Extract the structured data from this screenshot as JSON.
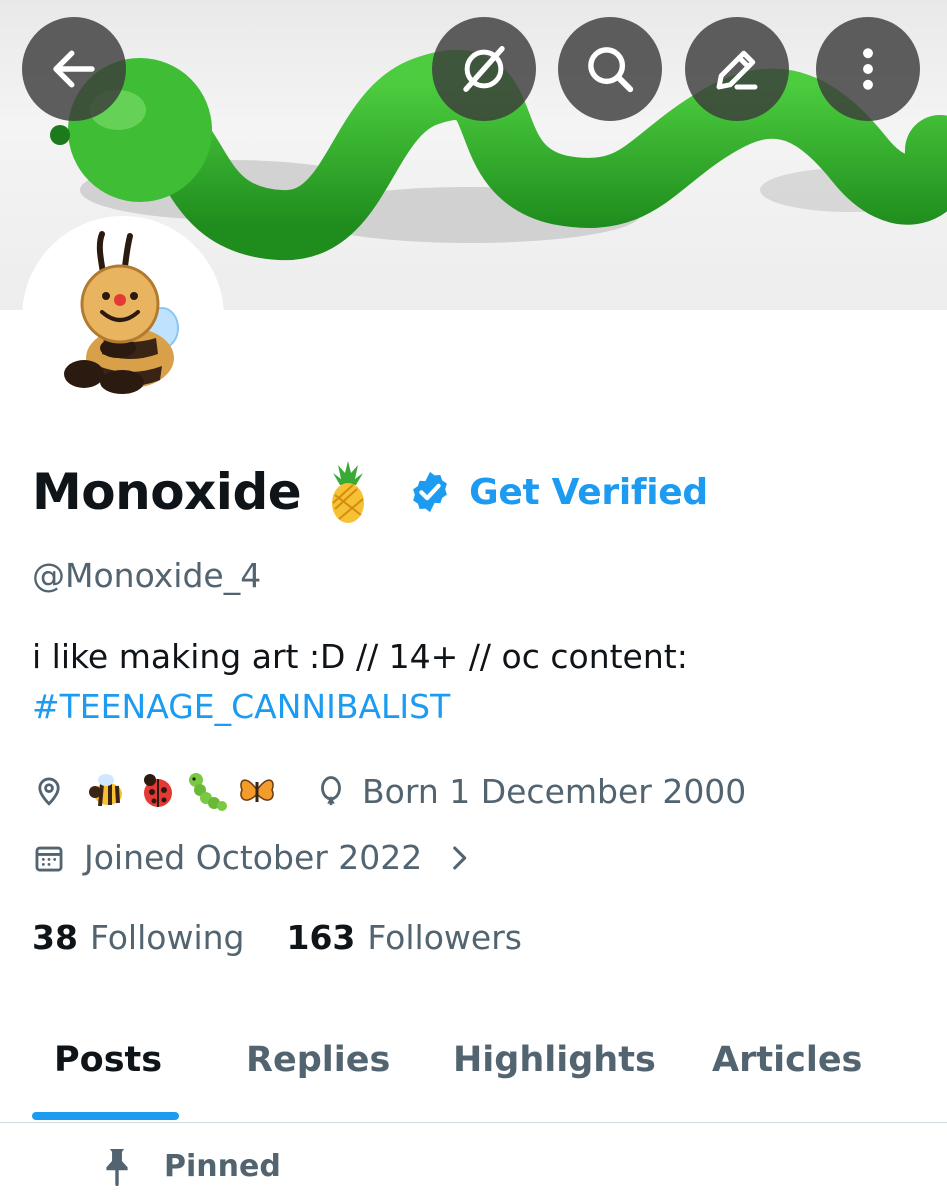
{
  "header": {
    "buttons": [
      {
        "name": "back",
        "icon": "arrow-left-icon"
      },
      {
        "name": "grok",
        "icon": "grok-icon"
      },
      {
        "name": "search",
        "icon": "search-icon"
      },
      {
        "name": "edit",
        "icon": "pencil-icon"
      },
      {
        "name": "more",
        "icon": "more-vertical-icon"
      }
    ],
    "banner_description_colors": {
      "worm": "#2fb32a",
      "background": "#eeeeee"
    }
  },
  "profile": {
    "display_name": "Monoxide",
    "name_emoji": "pineapple",
    "get_verified_label": "Get Verified",
    "handle": "@Monoxide_4",
    "bio_text": "i like making art :D // 14+ // oc content:",
    "bio_hashtag": "#TEENAGE_CANNIBALIST",
    "location_emojis": [
      "bee",
      "ladybug",
      "caterpillar",
      "butterfly"
    ],
    "birthday": "Born 1 December 2000",
    "joined": "Joined October 2022",
    "following_count": "38",
    "following_label": "Following",
    "followers_count": "163",
    "followers_label": "Followers"
  },
  "tabs": [
    {
      "label": "Posts",
      "active": true
    },
    {
      "label": "Replies",
      "active": false
    },
    {
      "label": "Highlights",
      "active": false
    },
    {
      "label": "Articles",
      "active": false
    }
  ],
  "pinned_label": "Pinned",
  "colors": {
    "accent": "#1d9bf0",
    "text": "#0f1419",
    "muted": "#536471"
  }
}
